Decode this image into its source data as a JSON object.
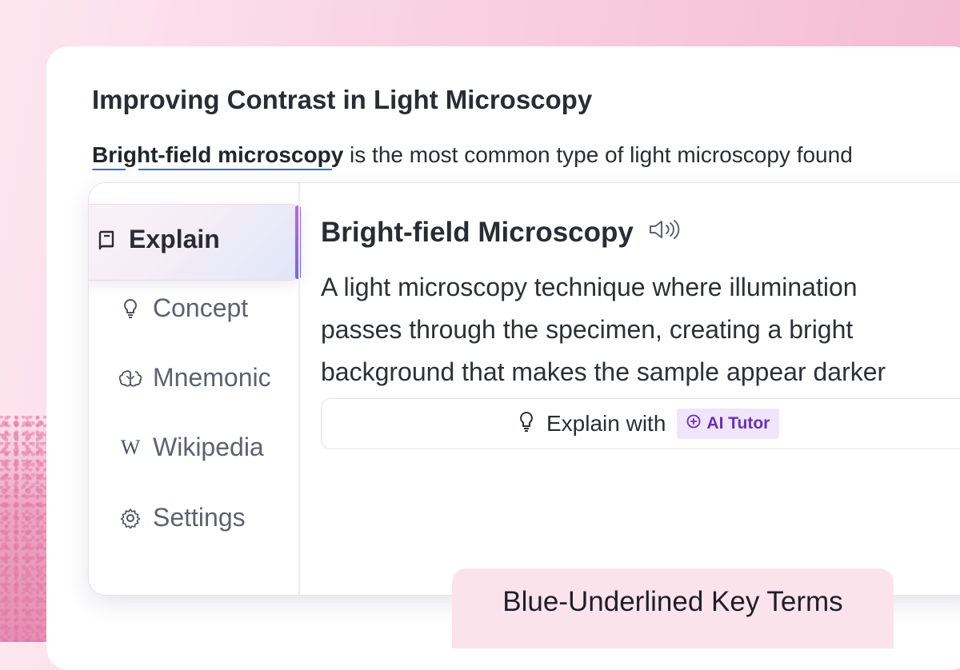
{
  "document": {
    "title": "Improving Contrast in Light Microscopy",
    "key_term": "Bright-field microscopy",
    "paragraph_rest": " is the most common type of light microscopy found"
  },
  "sidebar": {
    "items": [
      {
        "label": "Explain",
        "icon": "book-icon",
        "active": true
      },
      {
        "label": "Concept",
        "icon": "lightbulb-icon"
      },
      {
        "label": "Mnemonic",
        "icon": "brain-icon"
      },
      {
        "label": "Wikipedia",
        "icon": "wikipedia-icon"
      },
      {
        "label": "Settings",
        "icon": "gear-icon"
      }
    ]
  },
  "definition": {
    "title": "Bright-field Microscopy",
    "audio_icon": "speaker-icon",
    "lines": [
      "A light microscopy technique where illumination",
      "passes through the specimen, creating a bright",
      "background that makes the sample appear darker"
    ],
    "explain_label": "Explain with",
    "ai_badge": "AI Tutor"
  },
  "caption": "Blue-Underlined Key Terms",
  "colors": {
    "underline": "#2f6fd6",
    "accent_purple": "#6a2fb9",
    "caption_bg": "#fbe3ec"
  }
}
